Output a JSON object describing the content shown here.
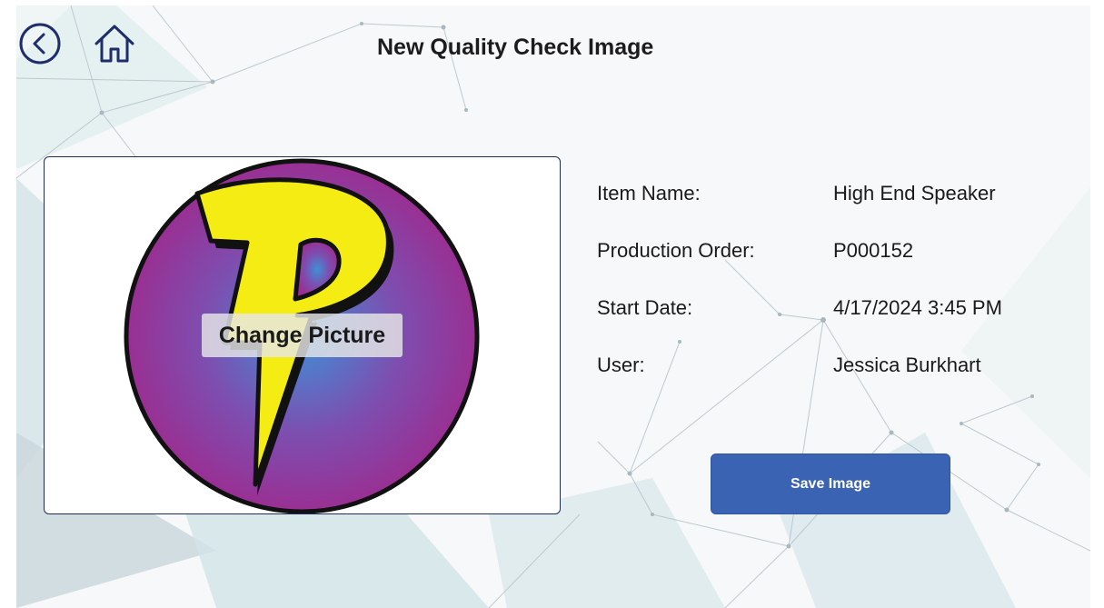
{
  "header": {
    "title": "New Quality Check Image",
    "back_icon": "circle-chevron-left-icon",
    "home_icon": "home-icon"
  },
  "picture": {
    "change_label": "Change Picture",
    "logo": "lightning-p-logo"
  },
  "details": [
    {
      "label": "Item Name:",
      "value": "High End Speaker"
    },
    {
      "label": "Production Order:",
      "value": "P000152"
    },
    {
      "label": "Start Date:",
      "value": "4/17/2024 3:45 PM"
    },
    {
      "label": "User:",
      "value": "Jessica Burkhart"
    }
  ],
  "actions": {
    "save_label": "Save Image"
  },
  "colors": {
    "nav_icon": "#1f2d6b",
    "button": "#3a63b4",
    "frame_border": "#1f2d5a"
  }
}
